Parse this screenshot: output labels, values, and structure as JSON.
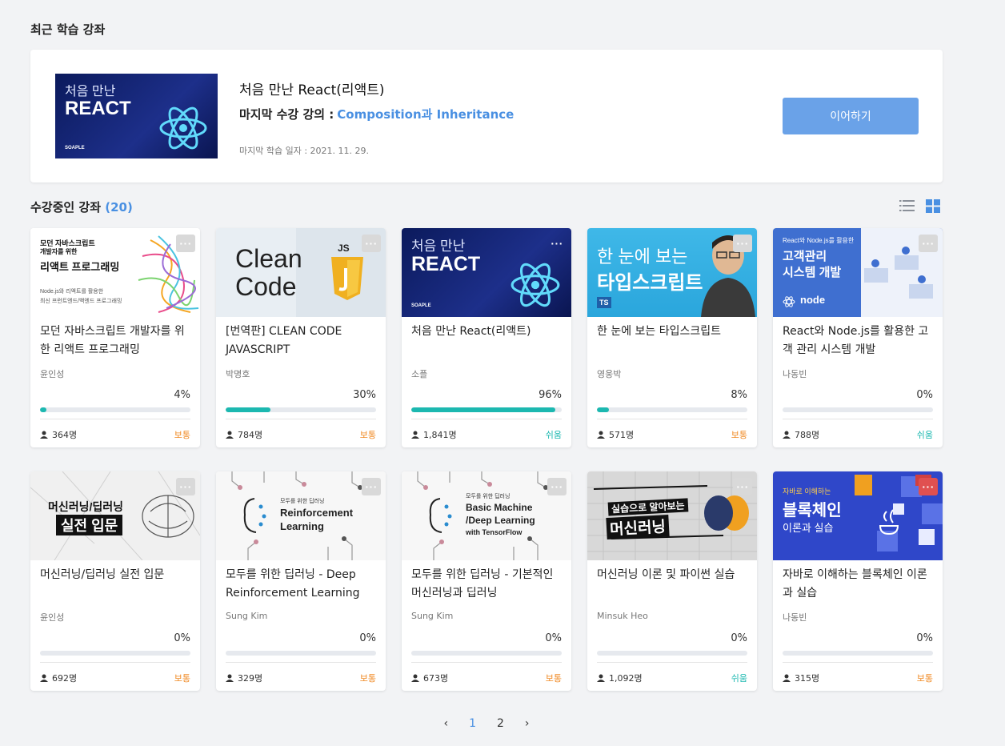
{
  "recent": {
    "section_title": "최근 학습 강좌",
    "course_title": "처음 만난 React(리액트)",
    "last_lecture_label": "마지막 수강 강의 :",
    "last_lecture_name": "Composition과 Inheritance",
    "last_date": "마지막 학습 일자 : 2021. 11. 29.",
    "continue_label": "이어하기",
    "thumb": {
      "line1": "처음 만난",
      "line2": "REACT",
      "brand": "SOAPLE"
    }
  },
  "enrolled": {
    "title": "수강중인 강좌",
    "count": "(20)"
  },
  "courses": [
    {
      "title": "모던 자바스크립트 개발자를 위한 리액트 프로그래밍",
      "author": "윤인성",
      "percent_label": "4%",
      "progress": 4,
      "students": "364명",
      "level": "보통",
      "level_type": "normal",
      "thumb": {
        "t1": "모던 자바스크립트",
        "t2": "개발자를 위한",
        "t3": "리액트 프로그래밍",
        "t4": "Node.js와 리액트를 활용한",
        "t5": "최신 프런트엔드/백엔드 프로그래밍"
      }
    },
    {
      "title": "[번역판] CLEAN CODE JAVASCRIPT",
      "author": "박명호",
      "percent_label": "30%",
      "progress": 30,
      "students": "784명",
      "level": "보통",
      "level_type": "normal",
      "thumb": {
        "t1": "Clean",
        "t2": "Code",
        "t3": "JS"
      }
    },
    {
      "title": "처음 만난 React(리액트)",
      "author": "소플",
      "percent_label": "96%",
      "progress": 96,
      "students": "1,841명",
      "level": "쉬움",
      "level_type": "easy",
      "thumb": {
        "t1": "처음 만난",
        "t2": "REACT",
        "t3": "SOAPLE"
      }
    },
    {
      "title": "한 눈에 보는 타입스크립트",
      "author": "영웅박",
      "percent_label": "8%",
      "progress": 8,
      "students": "571명",
      "level": "보통",
      "level_type": "normal",
      "thumb": {
        "t1": "한 눈에 보는",
        "t2": "타입스크립트",
        "t3": "TS"
      }
    },
    {
      "title": "React와 Node.js를 활용한 고객 관리 시스템 개발",
      "author": "나동빈",
      "percent_label": "0%",
      "progress": 0,
      "students": "788명",
      "level": "쉬움",
      "level_type": "easy",
      "thumb": {
        "t1": "React와 Node.js를 활용한",
        "t2": "고객관리",
        "t3": "시스템 개발",
        "t4": "node"
      }
    },
    {
      "title": "머신러닝/딥러닝 실전 입문",
      "author": "윤인성",
      "percent_label": "0%",
      "progress": 0,
      "students": "692명",
      "level": "보통",
      "level_type": "normal",
      "thumb": {
        "t1": "머신러닝/딥러닝",
        "t2": "실전 입문"
      }
    },
    {
      "title": "모두를 위한 딥러닝 - Deep Reinforcement Learning",
      "author": "Sung Kim",
      "percent_label": "0%",
      "progress": 0,
      "students": "329명",
      "level": "보통",
      "level_type": "normal",
      "thumb": {
        "t1": "모두를 위한 딥러닝",
        "t2": "Reinforcement",
        "t3": "Learning"
      }
    },
    {
      "title": "모두를 위한 딥러닝 - 기본적인 머신러닝과 딥러닝",
      "author": "Sung Kim",
      "percent_label": "0%",
      "progress": 0,
      "students": "673명",
      "level": "보통",
      "level_type": "normal",
      "thumb": {
        "t1": "모두를 위한 딥러닝",
        "t2": "Basic Machine",
        "t3": "/Deep Learning",
        "t4": "with TensorFlow"
      }
    },
    {
      "title": "머신러닝 이론 및 파이썬 실습",
      "author": "Minsuk Heo",
      "percent_label": "0%",
      "progress": 0,
      "students": "1,092명",
      "level": "쉬움",
      "level_type": "easy",
      "thumb": {
        "t1": "실습으로 알아보는",
        "t2": "머신러닝"
      }
    },
    {
      "title": "자바로 이해하는 블록체인 이론과 실습",
      "author": "나동빈",
      "percent_label": "0%",
      "progress": 0,
      "students": "315명",
      "level": "보통",
      "level_type": "normal",
      "thumb": {
        "t1": "자바로 이해하는",
        "t2": "블록체인",
        "t3": "이론과 실습"
      }
    }
  ],
  "pagination": {
    "prev": "‹",
    "pages": [
      "1",
      "2"
    ],
    "next": "›",
    "current": "1"
  },
  "colors": {
    "accent": "#4a90e2",
    "progress": "#1cb8b0",
    "normal": "#f08a24",
    "easy": "#1cb8b0",
    "button": "#6aa2e8"
  },
  "icons": [
    "list-view-icon",
    "grid-view-icon",
    "user-icon",
    "more-icon",
    "chevron-left-icon",
    "chevron-right-icon",
    "react-logo-icon"
  ]
}
